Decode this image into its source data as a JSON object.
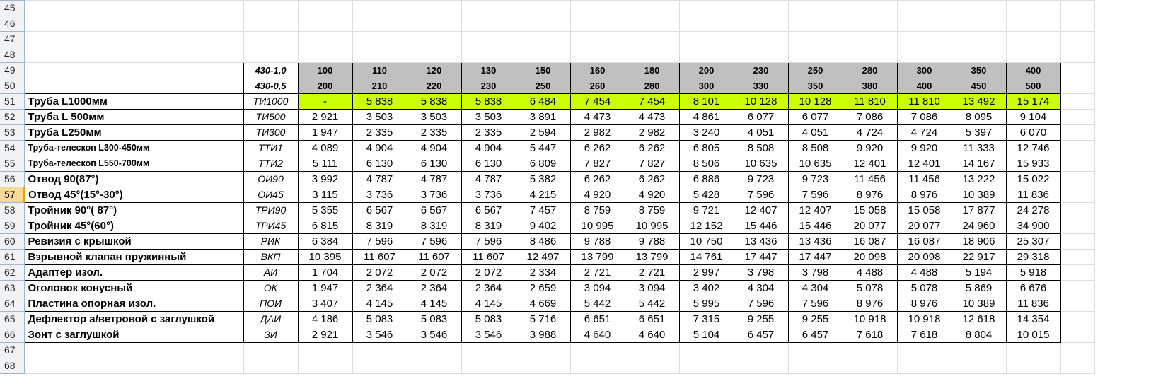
{
  "sheet": {
    "empty_rows_top": [
      "45",
      "46",
      "47",
      "48"
    ],
    "empty_rows_bottom": [
      "67",
      "68"
    ],
    "selected_row": "57",
    "header_rows": [
      {
        "row": "49",
        "code": "430-1,0",
        "values": [
          "100",
          "110",
          "120",
          "130",
          "150",
          "160",
          "180",
          "200",
          "230",
          "250",
          "280",
          "300",
          "350",
          "400"
        ]
      },
      {
        "row": "50",
        "code": "430-0,5",
        "values": [
          "200",
          "210",
          "220",
          "230",
          "250",
          "260",
          "280",
          "300",
          "330",
          "350",
          "380",
          "400",
          "450",
          "500"
        ]
      }
    ],
    "highlight_color": "#ccff00",
    "header_fill": "#c0c0c0",
    "data_rows": [
      {
        "row": "51",
        "name": "Труба  L1000мм",
        "code": "ТИ1000",
        "values": [
          "-",
          "5 838",
          "5 838",
          "5 838",
          "6 484",
          "7 454",
          "7 454",
          "8 101",
          "10 128",
          "10 128",
          "11 810",
          "11 810",
          "13 492",
          "15 174"
        ]
      },
      {
        "row": "52",
        "name": "Труба  L 500мм",
        "code": "ТИ500",
        "values": [
          "2 921",
          "3 503",
          "3 503",
          "3 503",
          "3 891",
          "4 473",
          "4 473",
          "4 861",
          "6 077",
          "6 077",
          "7 086",
          "7 086",
          "8 095",
          "9 104"
        ]
      },
      {
        "row": "53",
        "name": "Труба  L250мм",
        "code": "ТИ300",
        "values": [
          "1 947",
          "2 335",
          "2 335",
          "2 335",
          "2 594",
          "2 982",
          "2 982",
          "3 240",
          "4 051",
          "4 051",
          "4 724",
          "4 724",
          "5 397",
          "6 070"
        ]
      },
      {
        "row": "54",
        "name": "Труба-телескоп L300-450мм",
        "code": "ТТИ1",
        "values": [
          "4 089",
          "4 904",
          "4 904",
          "4 904",
          "5 447",
          "6 262",
          "6 262",
          "6 805",
          "8 508",
          "8 508",
          "9 920",
          "9 920",
          "11 333",
          "12 746"
        ]
      },
      {
        "row": "55",
        "name": "Труба-телескоп L550-700мм",
        "code": "ТТИ2",
        "values": [
          "5 111",
          "6 130",
          "6 130",
          "6 130",
          "6 809",
          "7 827",
          "7 827",
          "8 506",
          "10 635",
          "10 635",
          "12 401",
          "12 401",
          "14 167",
          "15 933"
        ]
      },
      {
        "row": "56",
        "name": "Отвод 90(87°)",
        "code": "ОИ90",
        "values": [
          "3 992",
          "4 787",
          "4 787",
          "4 787",
          "5 382",
          "6 262",
          "6 262",
          "6 886",
          "9 723",
          "9 723",
          "11 456",
          "11 456",
          "13 222",
          "15 022"
        ]
      },
      {
        "row": "57",
        "name": "Отвод 45°(15°-30°)",
        "code": "ОИ45",
        "values": [
          "3 115",
          "3 736",
          "3 736",
          "3 736",
          "4 215",
          "4 920",
          "4 920",
          "5 428",
          "7 596",
          "7 596",
          "8 976",
          "8 976",
          "10 389",
          "11 836"
        ]
      },
      {
        "row": "58",
        "name": "Тройник 90°( 87°)",
        "code": "ТРИ90",
        "values": [
          "5 355",
          "6 567",
          "6 567",
          "6 567",
          "7 457",
          "8 759",
          "8 759",
          "9 721",
          "12 407",
          "12 407",
          "15 058",
          "15 058",
          "17 877",
          "24 278"
        ]
      },
      {
        "row": "59",
        "name": "Тройник 45°(60°)",
        "code": "ТРИ45",
        "values": [
          "6 815",
          "8 319",
          "8 319",
          "8 319",
          "9 402",
          "10 995",
          "10 995",
          "12 152",
          "15 446",
          "15 446",
          "20 077",
          "20 077",
          "24 960",
          "34 900"
        ]
      },
      {
        "row": "60",
        "name": "Ревизия с крышкой",
        "code": "РИК",
        "values": [
          "6 384",
          "7 596",
          "7 596",
          "7 596",
          "8 486",
          "9 788",
          "9 788",
          "10 750",
          "13 436",
          "13 436",
          "16 087",
          "16 087",
          "18 906",
          "25 307"
        ]
      },
      {
        "row": "61",
        "name": "Взрывной клапан пружинный",
        "code": "ВКП",
        "values": [
          "10 395",
          "11 607",
          "11 607",
          "11 607",
          "12 497",
          "13 799",
          "13 799",
          "14 761",
          "17 447",
          "17 447",
          "20 098",
          "20 098",
          "22 917",
          "29 318"
        ]
      },
      {
        "row": "62",
        "name": "Адаптер изол.",
        "code": "АИ",
        "values": [
          "1 704",
          "2 072",
          "2 072",
          "2 072",
          "2 334",
          "2 721",
          "2 721",
          "2 997",
          "3 798",
          "3 798",
          "4 488",
          "4 488",
          "5 194",
          "5 918"
        ]
      },
      {
        "row": "63",
        "name": "Оголовок конусный",
        "code": "ОК",
        "values": [
          "1 947",
          "2 364",
          "2 364",
          "2 364",
          "2 659",
          "3 094",
          "3 094",
          "3 402",
          "4 304",
          "4 304",
          "5 078",
          "5 078",
          "5 869",
          "6 676"
        ]
      },
      {
        "row": "64",
        "name": "Пластина опорная изол.",
        "code": "ПОИ",
        "values": [
          "3 407",
          "4 145",
          "4 145",
          "4 145",
          "4 669",
          "5 442",
          "5 442",
          "5 995",
          "7 596",
          "7 596",
          "8 976",
          "8 976",
          "10 389",
          "11 836"
        ]
      },
      {
        "row": "65",
        "name": "Дефлектор а/ветровой с заглушкой",
        "code": "ДАИ",
        "values": [
          "4 186",
          "5 083",
          "5 083",
          "5 083",
          "5 716",
          "6 651",
          "6 651",
          "7 315",
          "9 255",
          "9 255",
          "10 918",
          "10 918",
          "12 618",
          "14 354"
        ]
      },
      {
        "row": "66",
        "name": "Зонт с заглушкой",
        "code": "ЗИ",
        "values": [
          "2 921",
          "3 546",
          "3 546",
          "3 546",
          "3 988",
          "4 640",
          "4 640",
          "5 104",
          "6 457",
          "6 457",
          "7 618",
          "7 618",
          "8 804",
          "10 015"
        ]
      }
    ]
  }
}
